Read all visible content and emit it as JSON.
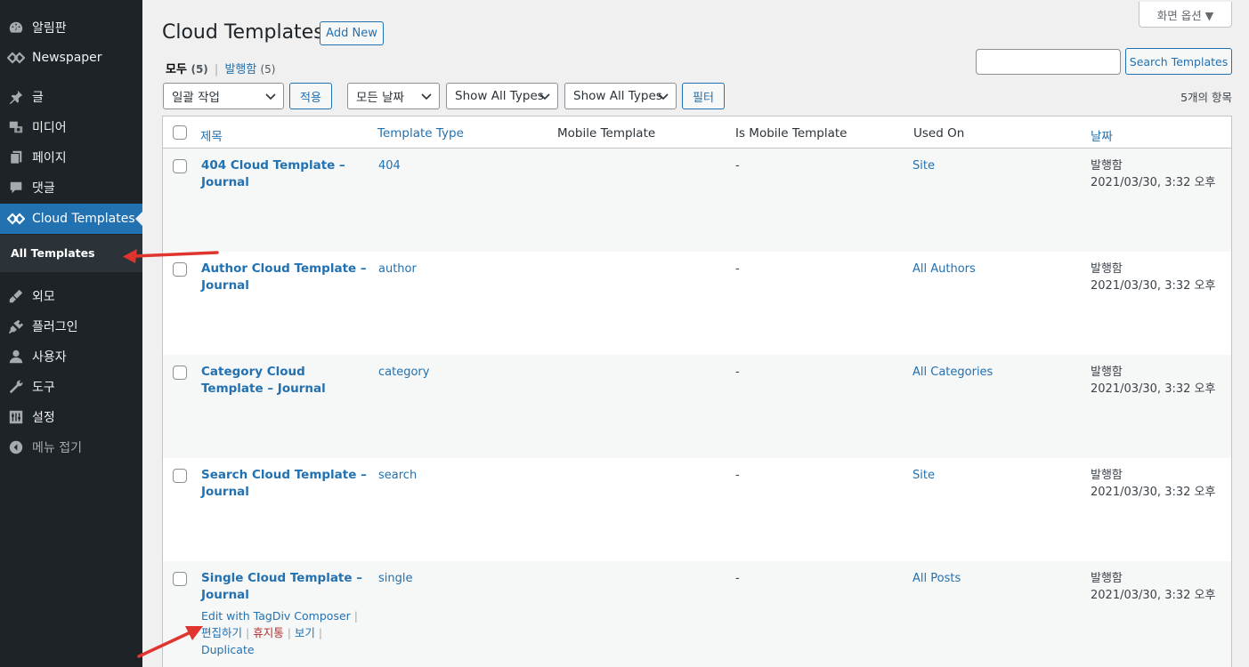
{
  "sidebar": {
    "items": [
      {
        "label": "알림판",
        "icon": "dashboard-icon"
      },
      {
        "label": "Newspaper",
        "icon": "newspaper-icon"
      },
      {
        "label": "글",
        "icon": "pin-icon"
      },
      {
        "label": "미디어",
        "icon": "media-icon"
      },
      {
        "label": "페이지",
        "icon": "pages-icon"
      },
      {
        "label": "댓글",
        "icon": "comments-icon"
      },
      {
        "label": "Cloud Templates",
        "icon": "cloud-templates-icon"
      },
      {
        "label": "외모",
        "icon": "appearance-icon"
      },
      {
        "label": "플러그인",
        "icon": "plugins-icon"
      },
      {
        "label": "사용자",
        "icon": "users-icon"
      },
      {
        "label": "도구",
        "icon": "tools-icon"
      },
      {
        "label": "설정",
        "icon": "settings-icon"
      },
      {
        "label": "메뉴 접기",
        "icon": "collapse-icon"
      }
    ],
    "submenu": {
      "label": "All Templates"
    }
  },
  "header": {
    "screen_options": "화면 옵션 ▼",
    "title": "Cloud Templates",
    "add_new": "Add New"
  },
  "views": {
    "all_label": "모두",
    "all_count": "(5)",
    "separator": "|",
    "published_label": "발행함",
    "published_count": "(5)"
  },
  "search": {
    "value": "",
    "button": "Search Templates"
  },
  "filters": {
    "bulk_action": "일괄 작업",
    "apply": "적용",
    "date": "모든 날짜",
    "type1": "Show All Types",
    "type2": "Show All Types",
    "filter": "필터",
    "items_count": "5개의 항목"
  },
  "table": {
    "columns": {
      "title": "제목",
      "template_type": "Template Type",
      "mobile_template": "Mobile Template",
      "is_mobile_template": "Is Mobile Template",
      "used_on": "Used On",
      "date": "날짜"
    },
    "rows": [
      {
        "title": "404 Cloud Template – Journal",
        "type": "404",
        "mobile": "",
        "is_mobile": "-",
        "used_on": "Site",
        "status": "발행함",
        "date": "2021/03/30, 3:32 오후"
      },
      {
        "title": "Author Cloud Template – Journal",
        "type": "author",
        "mobile": "",
        "is_mobile": "-",
        "used_on": "All Authors",
        "status": "발행함",
        "date": "2021/03/30, 3:32 오후"
      },
      {
        "title": "Category Cloud Template – Journal",
        "type": "category",
        "mobile": "",
        "is_mobile": "-",
        "used_on": "All Categories",
        "status": "발행함",
        "date": "2021/03/30, 3:32 오후"
      },
      {
        "title": "Search Cloud Template – Journal",
        "type": "search",
        "mobile": "",
        "is_mobile": "-",
        "used_on": "Site",
        "status": "발행함",
        "date": "2021/03/30, 3:32 오후"
      },
      {
        "title": "Single Cloud Template – Journal",
        "type": "single",
        "mobile": "",
        "is_mobile": "-",
        "used_on": "All Posts",
        "status": "발행함",
        "date": "2021/03/30, 3:32 오후"
      }
    ],
    "row_actions": {
      "edit_composer": "Edit with TagDiv Composer",
      "edit": "편집하기",
      "trash": "휴지통",
      "view": "보기",
      "duplicate": "Duplicate",
      "sep": "|"
    }
  },
  "colors": {
    "sidebar_bg": "#1d2327",
    "accent": "#2271b1",
    "annotation_arrow": "#e0342f"
  }
}
